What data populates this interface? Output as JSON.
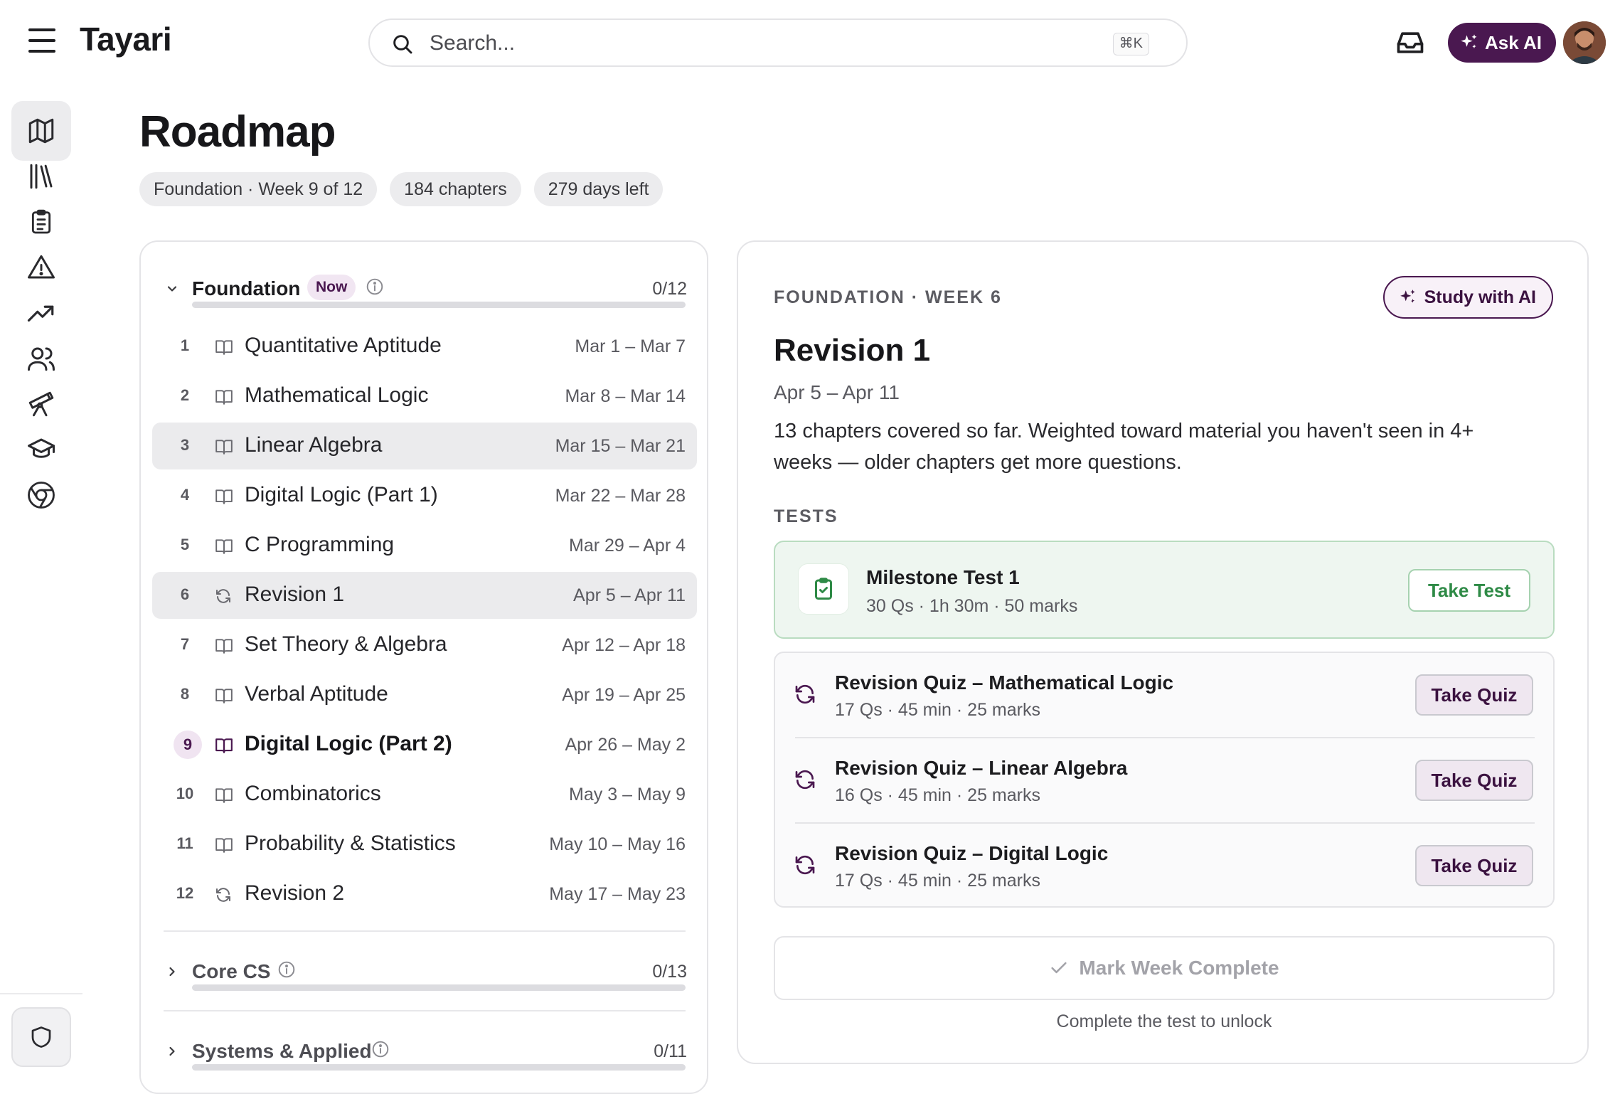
{
  "app": {
    "title": "Tayari",
    "search_placeholder": "Search...",
    "search_shortcut": "⌘K",
    "ask_ai_label": "Ask AI"
  },
  "colors": {
    "brand": "#4a1850",
    "success": "#2e8a46",
    "panel_border": "#e4e4e7"
  },
  "sidebar": {
    "items": [
      {
        "icon": "sparkles-icon",
        "active": false
      },
      {
        "icon": "map-icon",
        "active": true
      },
      {
        "icon": "library-icon",
        "active": false
      },
      {
        "icon": "clipboard-icon",
        "active": false
      },
      {
        "icon": "warning-icon",
        "active": false
      },
      {
        "icon": "trending-up-icon",
        "active": false
      },
      {
        "icon": "users-icon",
        "active": false
      },
      {
        "icon": "telescope-icon",
        "active": false
      },
      {
        "icon": "graduation-cap-icon",
        "active": false
      },
      {
        "icon": "chrome-icon",
        "active": false
      }
    ],
    "bottom_icon": "shield-icon"
  },
  "page": {
    "title": "Roadmap",
    "chips": [
      "Foundation · Week 9 of 12",
      "184 chapters",
      "279 days left"
    ]
  },
  "phases": [
    {
      "name": "Foundation",
      "badge": "Now",
      "count": "0/12",
      "progress": 0,
      "expanded": true,
      "weeks": [
        {
          "num": "1",
          "name": "Quantitative Aptitude",
          "dates": "Mar 1 – Mar 7",
          "icon": "book-icon"
        },
        {
          "num": "2",
          "name": "Mathematical Logic",
          "dates": "Mar 8 – Mar 14",
          "icon": "book-icon"
        },
        {
          "num": "3",
          "name": "Linear Algebra",
          "dates": "Mar 15 – Mar 21",
          "icon": "book-icon"
        },
        {
          "num": "4",
          "name": "Digital Logic (Part 1)",
          "dates": "Mar 22 – Mar 28",
          "icon": "book-icon"
        },
        {
          "num": "5",
          "name": "C Programming",
          "dates": "Mar 29 – Apr 4",
          "icon": "book-icon"
        },
        {
          "num": "6",
          "name": "Revision 1",
          "dates": "Apr 5 – Apr 11",
          "icon": "refresh-icon"
        },
        {
          "num": "7",
          "name": "Set Theory & Algebra",
          "dates": "Apr 12 – Apr 18",
          "icon": "book-icon"
        },
        {
          "num": "8",
          "name": "Verbal Aptitude",
          "dates": "Apr 19 – Apr 25",
          "icon": "book-icon"
        },
        {
          "num": "9",
          "name": "Digital Logic (Part 2)",
          "dates": "Apr 26 – May 2",
          "icon": "book-icon"
        },
        {
          "num": "10",
          "name": "Combinatorics",
          "dates": "May 3 – May 9",
          "icon": "book-icon"
        },
        {
          "num": "11",
          "name": "Probability & Statistics",
          "dates": "May 10 – May 16",
          "icon": "book-icon"
        },
        {
          "num": "12",
          "name": "Revision 2",
          "dates": "May 17 – May 23",
          "icon": "refresh-icon"
        }
      ]
    },
    {
      "name": "Core CS",
      "count": "0/13",
      "progress": 0,
      "expanded": false
    },
    {
      "name": "Systems & Applied",
      "count": "0/11",
      "progress": 0,
      "expanded": false
    }
  ],
  "detail": {
    "eyebrow": "FOUNDATION · WEEK 6",
    "study_label": "Study with AI",
    "title": "Revision 1",
    "dates": "Apr 5 – Apr 11",
    "description": "13 chapters covered so far. Weighted toward material you haven't seen in 4+ weeks — older chapters get more questions.",
    "tests_label": "TESTS",
    "milestone": {
      "name": "Milestone Test 1",
      "meta": "30 Qs · 1h 30m · 50 marks",
      "action": "Take Test"
    },
    "quizzes": [
      {
        "name": "Revision Quiz – Mathematical Logic",
        "meta": "17 Qs · 45 min · 25 marks",
        "action": "Take Quiz"
      },
      {
        "name": "Revision Quiz – Linear Algebra",
        "meta": "16 Qs · 45 min · 25 marks",
        "action": "Take Quiz"
      },
      {
        "name": "Revision Quiz – Digital Logic",
        "meta": "17 Qs · 45 min · 25 marks",
        "action": "Take Quiz"
      }
    ],
    "complete_label": "Mark Week Complete",
    "unlock_note": "Complete the test to unlock"
  }
}
